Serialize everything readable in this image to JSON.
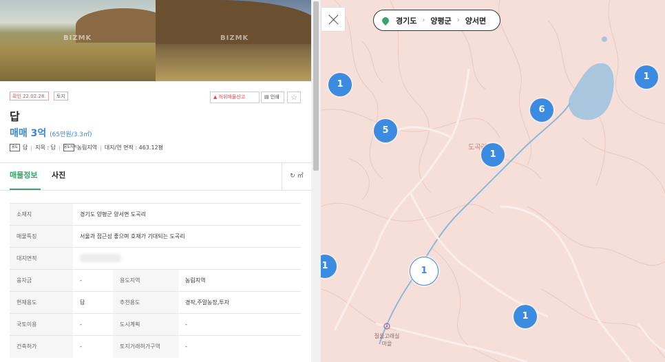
{
  "listing": {
    "photo_watermark": "BIZMK",
    "confirm_tag": "확인 22.02.28.",
    "type_tag": "토지",
    "report_button": "허위매물신고",
    "print_button": "인쇄",
    "title": "답",
    "price_main": "매매 3억",
    "price_unit": "(65만원/3.3㎡)",
    "attributes": [
      {
        "icon_label": "용도",
        "text": "답"
      },
      {
        "icon_label": "",
        "text": "지목 : 답"
      },
      {
        "icon_label": "용도지역",
        "text": "농림지역"
      },
      {
        "icon_label": "",
        "text": "대지/연 면적 : 463.12평"
      }
    ]
  },
  "tabs": {
    "info": "매물정보",
    "photo": "사진",
    "unit_toggle": "㎡"
  },
  "table": {
    "address_label": "소재지",
    "address_value": "경기도 양평군 양서면 도곡리",
    "feature_label": "매물특징",
    "feature_value": "서울과 접근성 좋으며 호재가 기대되는 도곡리",
    "land_area_label": "대지면적",
    "rows": [
      {
        "l1": "융자금",
        "v1": "-",
        "l2": "용도지역",
        "v2": "농림지역"
      },
      {
        "l1": "현재용도",
        "v1": "답",
        "l2": "추천용도",
        "v2": "경작,주말농장,투자"
      },
      {
        "l1": "국토이용",
        "v1": "-",
        "l2": "도시계획",
        "v2": "-"
      },
      {
        "l1": "건축허가",
        "v1": "-",
        "l2": "토지거래허가구역",
        "v2": "-"
      }
    ]
  },
  "map": {
    "breadcrumb": [
      "경기도",
      "양평군",
      "양서면"
    ],
    "area_label": "도곡리",
    "village_label_1": "질울고래실",
    "village_label_2": "마을",
    "clusters": {
      "c1": "1",
      "c2": "1",
      "c3": "6",
      "c4": "5",
      "c5": "1",
      "c6": "1",
      "c7": "1",
      "c8": "1"
    },
    "colors": {
      "cluster": "#3b8be0",
      "land": "#f6dfd9",
      "water": "#a9c6df"
    }
  }
}
